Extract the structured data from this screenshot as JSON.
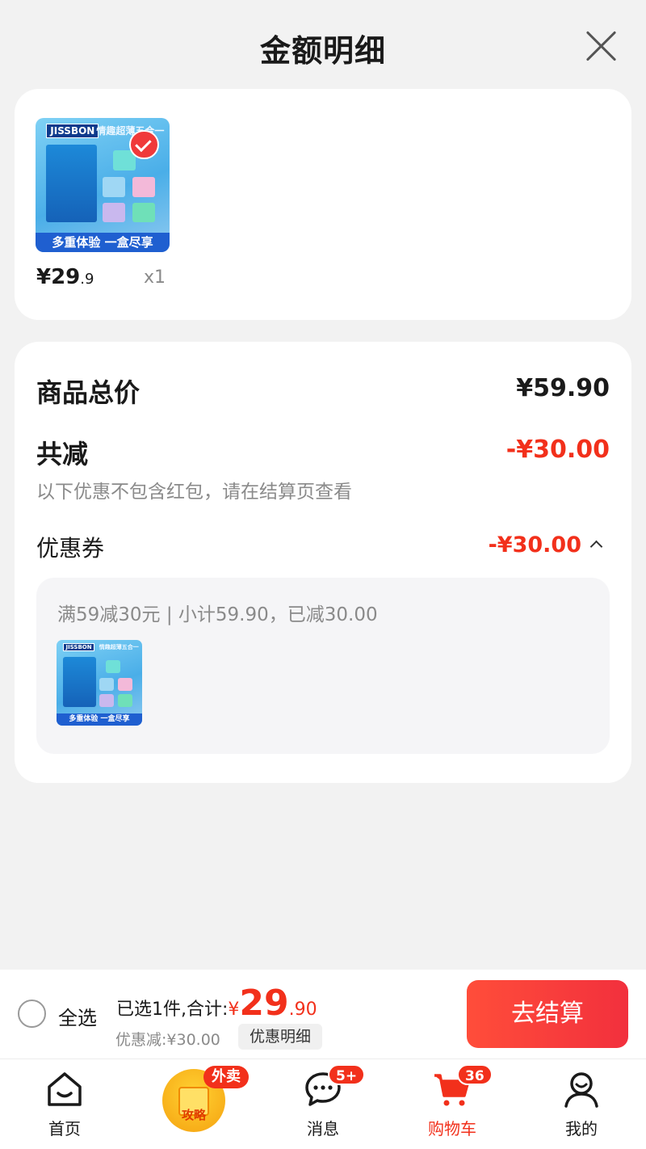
{
  "sheet": {
    "title": "金额明细"
  },
  "product": {
    "brand": "JISSBON",
    "tagline": "情趣超薄五合一",
    "banner": "多重体验 一盒尽享",
    "price_int": "¥29",
    "price_dec": ".9",
    "qty": "x1"
  },
  "summary": {
    "total_label": "商品总价",
    "total_value": "¥59.90",
    "reduce_label": "共减",
    "reduce_value": "-¥30.00",
    "reduce_note": "以下优惠不包含红包，请在结算页查看",
    "coupon_label": "优惠券",
    "coupon_value": "-¥30.00",
    "coupon_rule": "满59减30元 | 小计59.90，已减30.00"
  },
  "checkout": {
    "select_all": "全选",
    "selected_text": "已选1件,合计:",
    "total_yen": "¥",
    "total_int": "29",
    "total_dec": ".90",
    "discount_text": "优惠减:¥30.00",
    "discount_detail": "优惠明细",
    "checkout_button": "去结算"
  },
  "tabbar": {
    "home": "首页",
    "guide_badge": "外卖",
    "guide_text": "攻略",
    "messages": "消息",
    "messages_badge": "5+",
    "cart": "购物车",
    "cart_badge": "36",
    "me": "我的"
  },
  "colors": {
    "accent": "#f2301b",
    "checkout_button": "#f2303d"
  }
}
